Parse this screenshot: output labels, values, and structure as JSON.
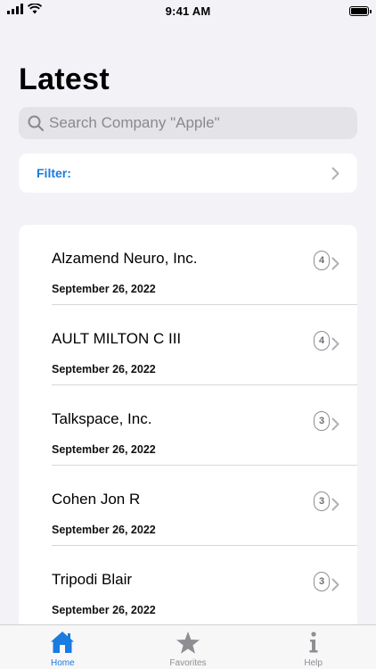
{
  "status_bar": {
    "time": "9:41 AM"
  },
  "page": {
    "title": "Latest"
  },
  "search": {
    "placeholder": "Search Company \"Apple\""
  },
  "filter": {
    "label": "Filter:"
  },
  "list": {
    "items": [
      {
        "title": "Alzamend Neuro, Inc.",
        "date": "September 26, 2022",
        "count": "4"
      },
      {
        "title": "AULT MILTON C III",
        "date": "September 26, 2022",
        "count": "4"
      },
      {
        "title": "Talkspace, Inc.",
        "date": "September 26, 2022",
        "count": "3"
      },
      {
        "title": "Cohen Jon R",
        "date": "September 26, 2022",
        "count": "3"
      },
      {
        "title": "Tripodi Blair",
        "date": "September 26, 2022",
        "count": "3"
      }
    ]
  },
  "tab_bar": {
    "tabs": [
      {
        "label": "Home",
        "icon": "home-icon",
        "active": true
      },
      {
        "label": "Favorites",
        "icon": "star-icon",
        "active": false
      },
      {
        "label": "Help",
        "icon": "info-icon",
        "active": false
      }
    ]
  },
  "colors": {
    "accent": "#1a7be0",
    "background": "#f2f2f7",
    "inactive": "#8e8e93"
  }
}
